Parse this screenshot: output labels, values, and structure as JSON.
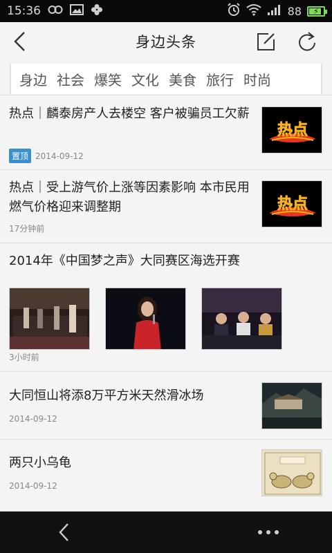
{
  "status_bar": {
    "time": "15:36",
    "battery": "88",
    "battery_level": 0.88,
    "left_icons": [
      "infinity-icon",
      "image-icon",
      "clover-icon"
    ],
    "right_icons": [
      "alarm-icon",
      "wifi-icon",
      "signal-icon",
      "battery-icon"
    ]
  },
  "header": {
    "title": "身边头条",
    "back_icon": "back-arrow-icon",
    "edit_icon": "edit-icon",
    "refresh_icon": "refresh-icon"
  },
  "tabs": [
    "身边",
    "社会",
    "爆笑",
    "文化",
    "美食",
    "旅行",
    "时尚"
  ],
  "news": [
    {
      "headline": "热点｜麟泰房产人去楼空 客户被骗员工欠薪",
      "pin_label": "置顶",
      "date": "2014-09-12",
      "thumb_text": "热点"
    },
    {
      "headline": "热点｜受上游气价上涨等因素影响 本市民用燃气价格迎来调整期",
      "date": "17分钟前",
      "thumb_text": "热点"
    },
    {
      "headline": "2014年《中国梦之声》大同赛区海选开赛",
      "date": "3小时前"
    },
    {
      "headline": "大同恒山将添8万平方米天然滑冰场",
      "date": "2014-09-12"
    },
    {
      "headline": "两只小乌龟",
      "date": "2014-09-12"
    }
  ],
  "bottom_nav": {
    "back_icon": "back-chevron-icon",
    "more_icon": "more-dots-icon"
  },
  "colors": {
    "pin": "#3b8fd0",
    "battery": "#7ed957",
    "status_bg": "#0a0a0a",
    "hot_red": "#e8361f",
    "hot_yellow": "#f5b21c"
  }
}
